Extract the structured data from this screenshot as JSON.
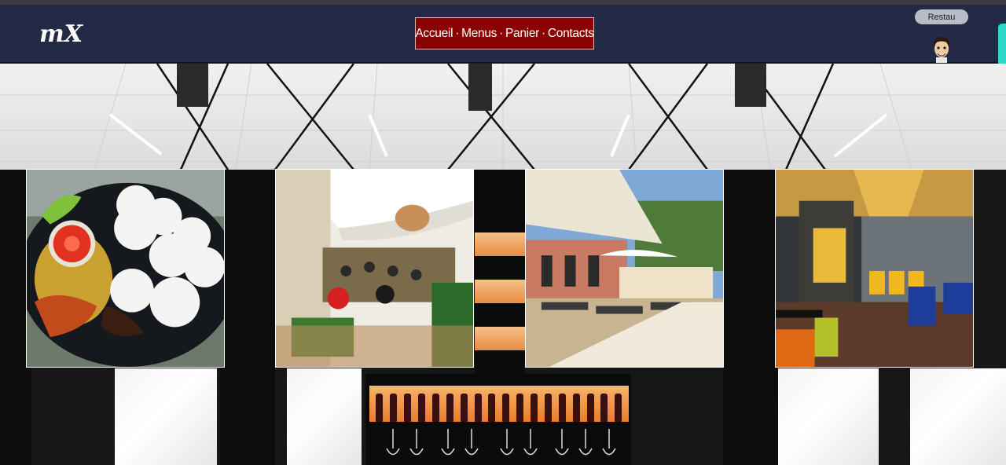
{
  "header": {
    "logo_text": "mX",
    "nav": {
      "items": [
        "Accueil",
        "Menus",
        "Panier",
        "Contacts"
      ],
      "separator": "·"
    },
    "restau_badge": "Restau"
  },
  "icons": {
    "avatar": "user-avatar-icon"
  },
  "gallery": {
    "photos": [
      {
        "name": "food-plate-photo"
      },
      {
        "name": "restaurant-terrace-photo"
      },
      {
        "name": "outdoor-patio-photo"
      },
      {
        "name": "restaurant-interior-photo"
      }
    ]
  },
  "colors": {
    "header_bg": "#222a45",
    "nav_bg": "#8b0000",
    "badge_bg": "#b8bcc6",
    "scroll_accent": "#2fd8c9"
  }
}
